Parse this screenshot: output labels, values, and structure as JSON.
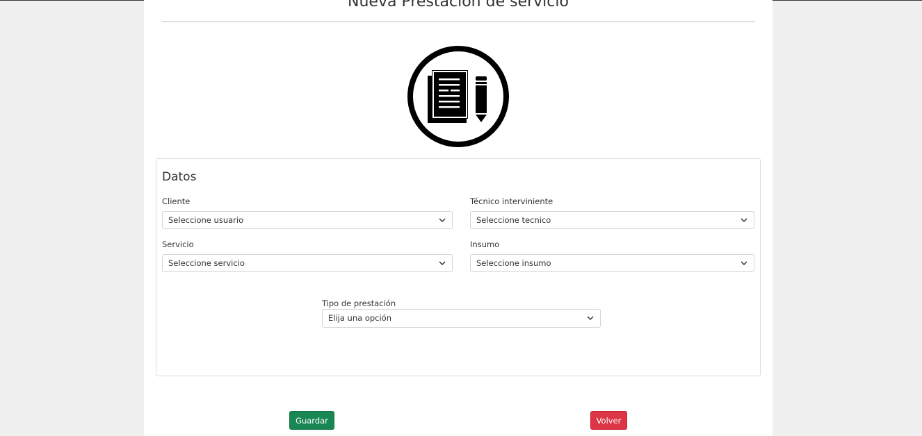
{
  "page": {
    "title": "Nueva Prestación de servicio"
  },
  "logo": {
    "icon": "document-pencil-icon"
  },
  "card": {
    "title": "Datos",
    "fields": {
      "cliente": {
        "label": "Cliente",
        "value": "Seleccione usuario"
      },
      "tecnico": {
        "label": "Técnico interviniente",
        "value": "Seleccione tecnico"
      },
      "servicio": {
        "label": "Servicio",
        "value": "Seleccione servicio"
      },
      "insumo": {
        "label": "Insumo",
        "value": "Seleccione insumo"
      },
      "tipo": {
        "label": "Tipo de prestación",
        "value": "Elija una opción"
      }
    }
  },
  "actions": {
    "save_label": "Guardar",
    "back_label": "Volver"
  },
  "colors": {
    "save": "#198754",
    "back": "#dc3545"
  }
}
